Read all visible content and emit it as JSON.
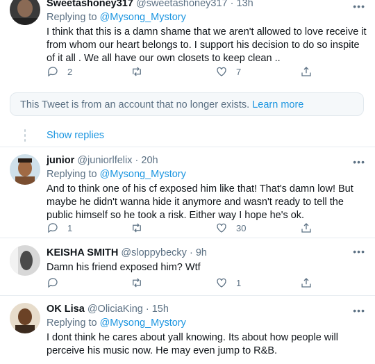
{
  "tweets": [
    {
      "name": "Sweetashoney317",
      "handle": "@sweetashoney317",
      "time": "13h",
      "replying_label": "Replying to",
      "replying_to": "@Mysong_Mystory",
      "text": "I think that this is a damn shame that we aren't allowed to love  receive it from whom our heart belongs to. I support his decision to do so inspite of it all . We all have our own closets to keep clean ..",
      "replies": "2",
      "retweets": "",
      "likes": "7"
    },
    {
      "name": "junior",
      "handle": "@juniorlfelix",
      "time": "20h",
      "replying_label": "Replying to",
      "replying_to": "@Mysong_Mystory",
      "text": "And to think one of his cf exposed him like that! That's damn low! But maybe he didn't wanna hide it anymore and wasn't ready to tell the public himself so he took a risk. Either way I hope he's ok.",
      "replies": "1",
      "retweets": "",
      "likes": "30"
    },
    {
      "name": "KEISHA SMITH",
      "handle": "@sloppybecky",
      "time": "9h",
      "text": "Damn his friend exposed him? Wtf",
      "replies": "",
      "retweets": "",
      "likes": "1"
    },
    {
      "name": "OK Lisa",
      "handle": "@OliciaKing",
      "time": "15h",
      "replying_label": "Replying to",
      "replying_to": "@Mysong_Mystory",
      "text": "I dont think he cares about yall knowing. Its about how people will perceive his music now. He may even jump to R&B."
    }
  ],
  "unavailable_notice": {
    "text": "This Tweet is from an account that no longer exists.",
    "link": "Learn more"
  },
  "show_replies": "Show replies",
  "separator": "·",
  "more_icon": "more-horizontal-icon"
}
